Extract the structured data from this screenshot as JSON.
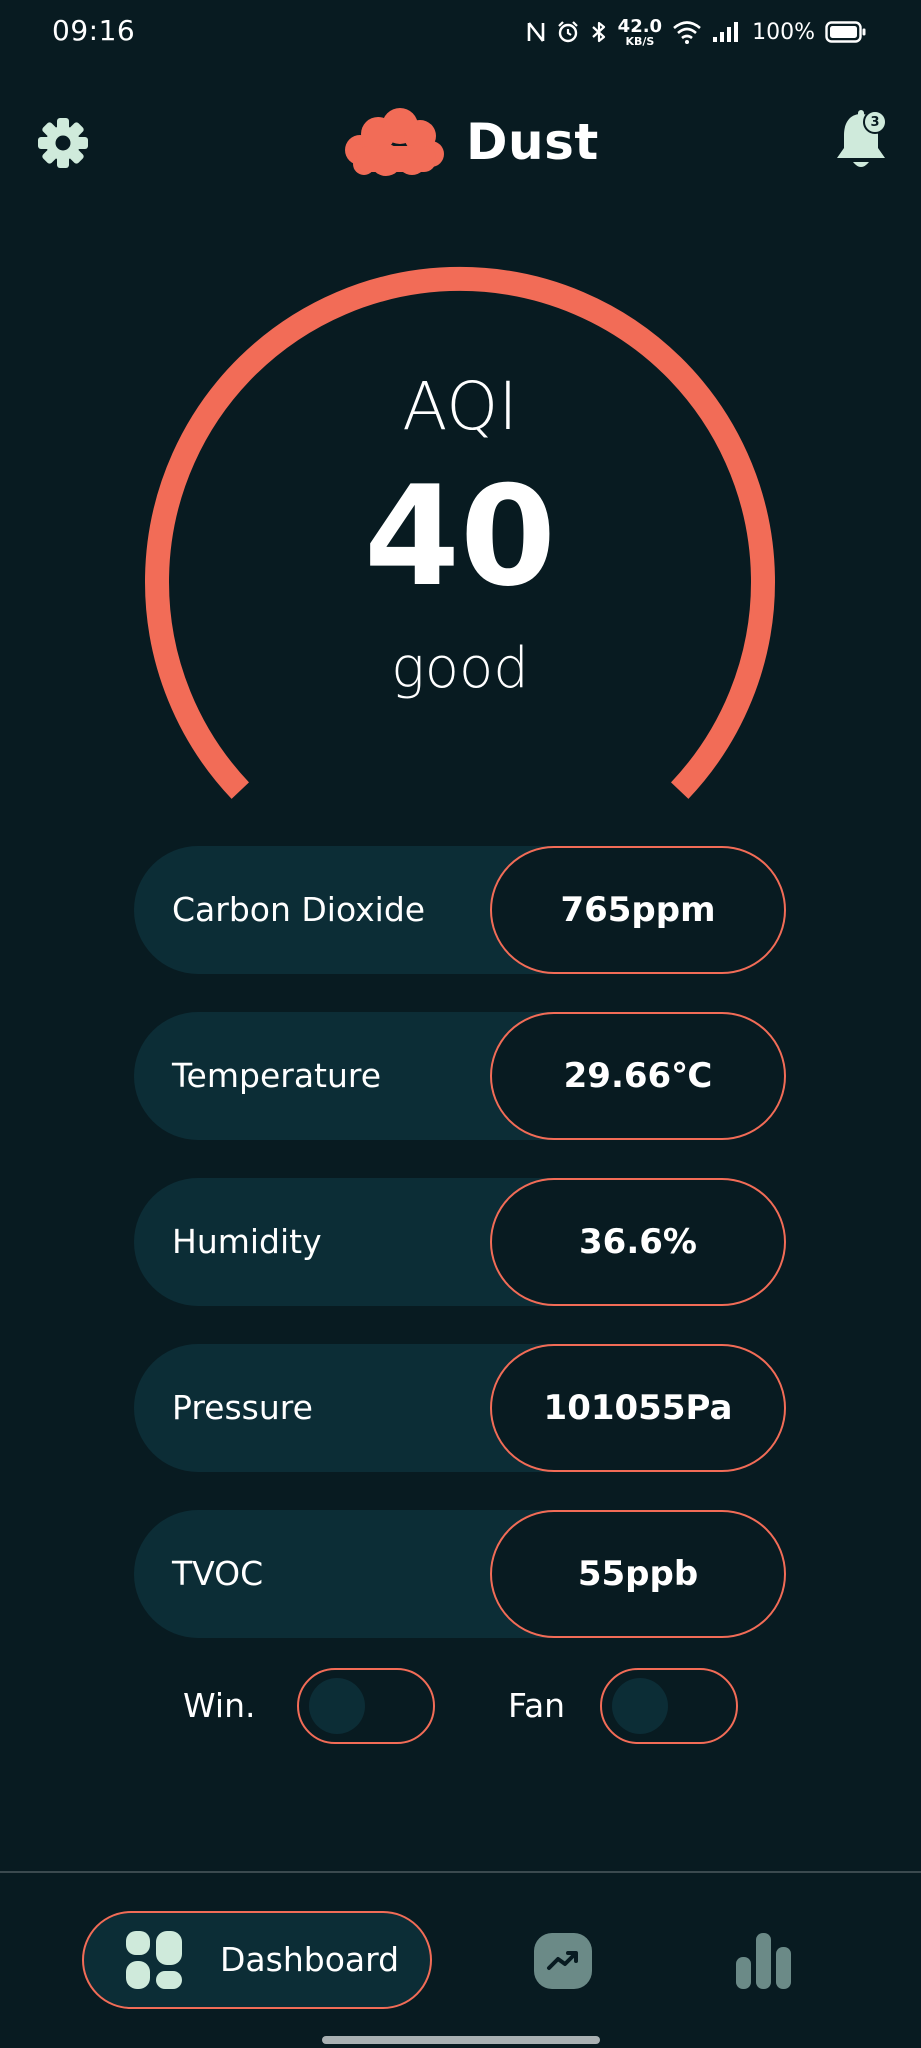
{
  "status_bar": {
    "time": "09:16",
    "net_speed_value": "42.0",
    "net_speed_unit": "KB/S",
    "battery": "100%"
  },
  "header": {
    "title": "Dust",
    "notification_count": "3"
  },
  "gauge": {
    "label": "AQI",
    "value": "40",
    "status": "good"
  },
  "metrics": [
    {
      "label": "Carbon Dioxide",
      "value": "765ppm"
    },
    {
      "label": "Temperature",
      "value": "29.66℃"
    },
    {
      "label": "Humidity",
      "value": "36.6%"
    },
    {
      "label": "Pressure",
      "value": "101055Pa"
    },
    {
      "label": "TVOC",
      "value": "55ppb"
    }
  ],
  "toggles": {
    "window": {
      "label": "Win.",
      "on": false
    },
    "fan": {
      "label": "Fan",
      "on": false
    }
  },
  "nav": {
    "dashboard_label": "Dashboard",
    "items": [
      "dashboard-icon",
      "trending-up-icon",
      "bar-chart-icon"
    ]
  },
  "colors": {
    "background": "#081b21",
    "accent": "#f26c57",
    "panel": "#0c2d36",
    "mint": "#cfeadb"
  }
}
